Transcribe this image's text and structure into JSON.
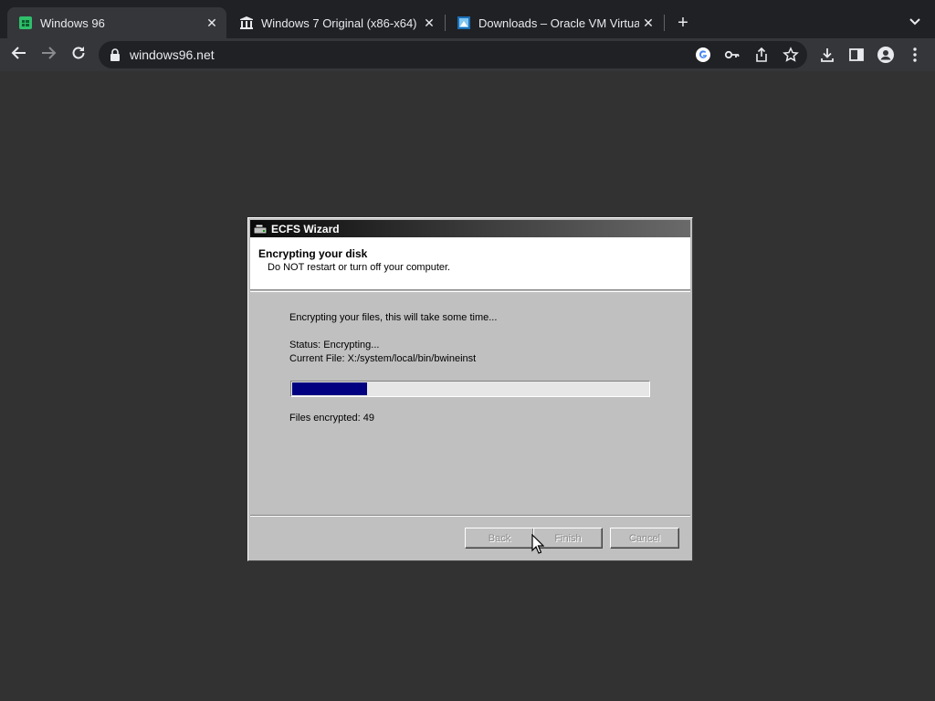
{
  "browser": {
    "tabs": [
      {
        "title": "Windows 96",
        "active": true,
        "favicon": "windows96-icon"
      },
      {
        "title": "Windows 7 Original (x86-x64)",
        "active": false,
        "favicon": "archive-icon"
      },
      {
        "title": "Downloads – Oracle VM Virtual",
        "active": false,
        "favicon": "virtualbox-icon"
      }
    ],
    "new_tab_label": "+",
    "url": "windows96.net"
  },
  "wizard": {
    "title": "ECFS Wizard",
    "header_title": "Encrypting your disk",
    "header_subtitle": "Do NOT restart or turn off your computer.",
    "intro": "Encrypting your files, this will take some time...",
    "status": "Status: Encrypting...",
    "current_file": "Current File: X:/system/local/bin/bwineinst",
    "progress_fraction": 0.21,
    "files_encrypted": "Files encrypted: 49",
    "buttons": {
      "back": "Back",
      "finish": "Finish",
      "cancel": "Cancel"
    }
  },
  "colors": {
    "progress_fill": "#000080",
    "desktop_bg": "#323232"
  }
}
